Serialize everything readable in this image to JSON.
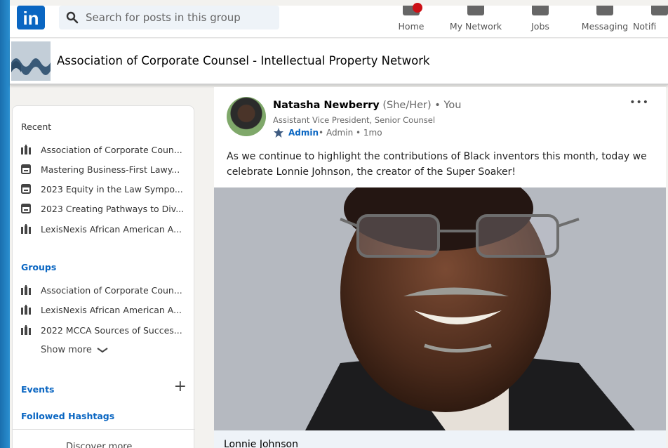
{
  "topbar": {
    "logo_text": "in",
    "search_placeholder": "Search for posts in this group",
    "nav": [
      {
        "label": "Home",
        "icon": "home-icon"
      },
      {
        "label": "My Network",
        "icon": "network-icon"
      },
      {
        "label": "Jobs",
        "icon": "briefcase-icon"
      },
      {
        "label": "Messaging",
        "icon": "messaging-icon"
      },
      {
        "label": "Notifi",
        "icon": "bell-icon"
      }
    ]
  },
  "group": {
    "title": "Association of Corporate Counsel - Intellectual Property Network"
  },
  "sidebar": {
    "recent_heading": "Recent",
    "recent": [
      {
        "label": "Association of Corporate Coun...",
        "icon": "group-icon"
      },
      {
        "label": "Mastering Business-First Lawy...",
        "icon": "calendar-icon"
      },
      {
        "label": "2023 Equity in the Law Sympo...",
        "icon": "calendar-icon"
      },
      {
        "label": "2023 Creating Pathways to Div...",
        "icon": "calendar-icon"
      },
      {
        "label": "LexisNexis African American A...",
        "icon": "group-icon"
      }
    ],
    "groups_heading": "Groups",
    "groups": [
      {
        "label": "Association of Corporate Coun...",
        "icon": "group-icon"
      },
      {
        "label": "LexisNexis African American A...",
        "icon": "group-icon"
      },
      {
        "label": "2022 MCCA Sources of Succes...",
        "icon": "group-icon"
      }
    ],
    "show_more": "Show more",
    "events": "Events",
    "followed_hashtags": "Followed Hashtags",
    "discover_more": "Discover more"
  },
  "post": {
    "author_name": "Natasha Newberry",
    "pronouns": "(She/Her)",
    "you": " • You",
    "subtitle": "Assistant Vice President, Senior Counsel",
    "admin_label": "Admin",
    "meta": " • Admin • 1mo",
    "more": "•••",
    "text": "As we continue to highlight the contributions of Black inventors this month, today we celebrate Lonnie Johnson, the creator of the Super Soaker!",
    "caption": "Lonnie Johnson"
  },
  "colors": {
    "brand": "#0a66c2",
    "background": "#f3f2ef",
    "frame": "#1b78b8"
  }
}
